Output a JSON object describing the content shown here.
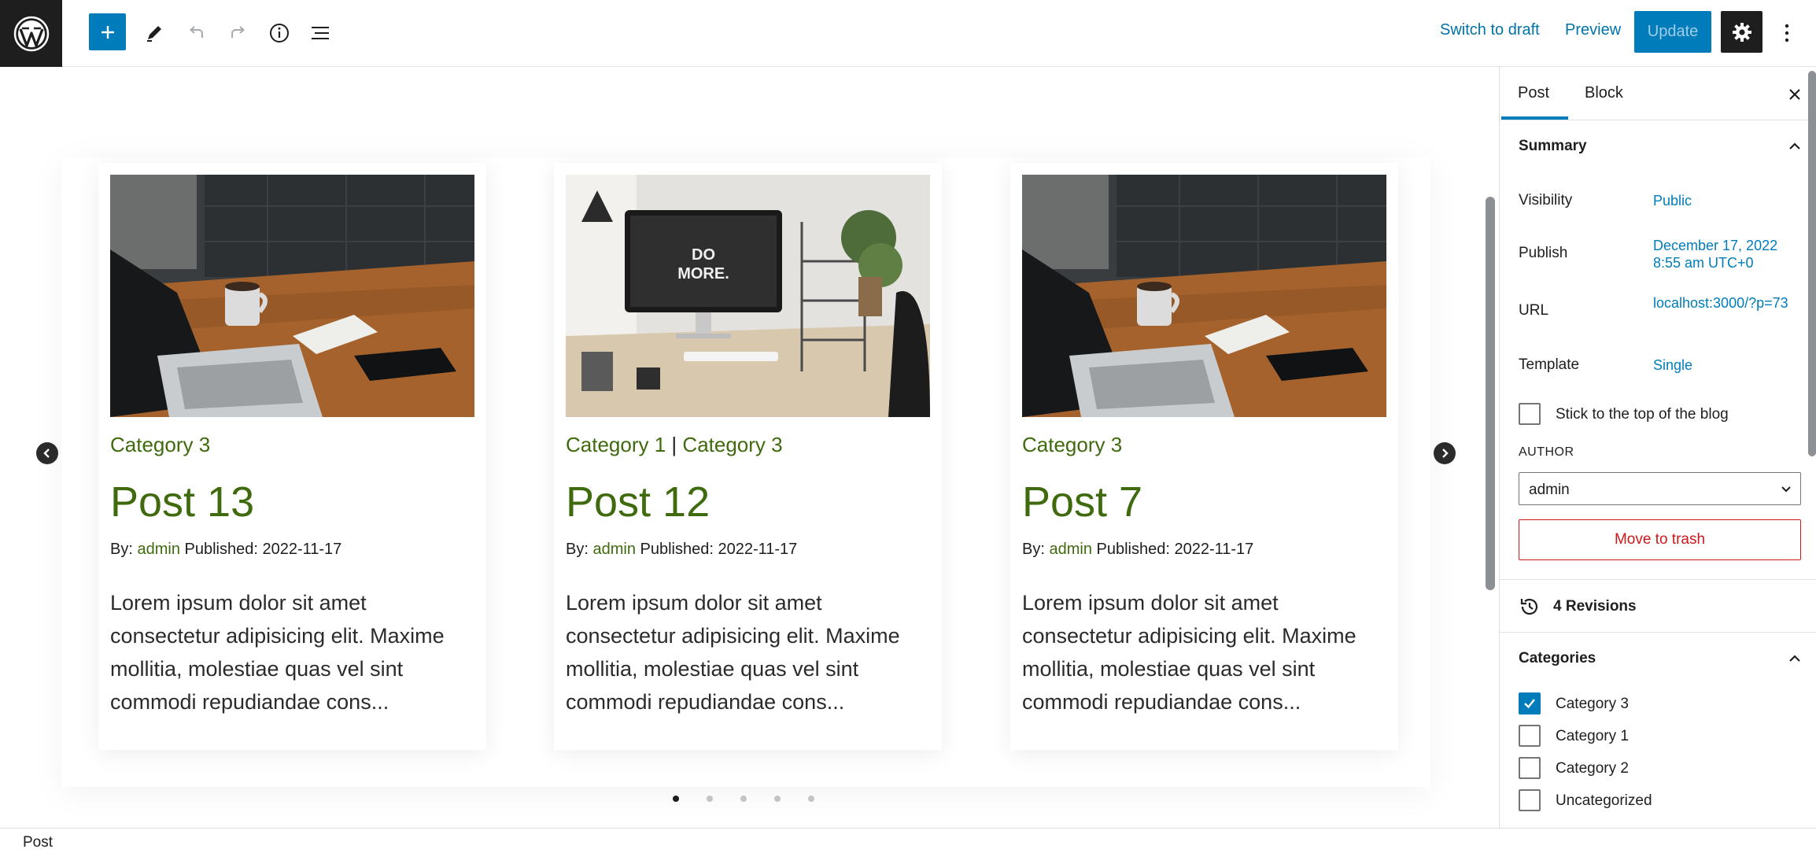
{
  "toolbar": {
    "switch_to_draft": "Switch to draft",
    "preview": "Preview",
    "update": "Update",
    "icons": [
      "wordpress-logo",
      "plus-icon",
      "pencil-icon",
      "undo-icon",
      "redo-icon",
      "info-icon",
      "list-view-icon",
      "gear-icon",
      "more-vertical-icon"
    ]
  },
  "carousel": {
    "cards": [
      {
        "image": "laptop-desk-photo",
        "category": "Category 3",
        "title": "Post 13",
        "by_label": "By:",
        "author": "admin",
        "published_label": "Published:",
        "date": "2022-11-17",
        "excerpt": "Lorem ipsum dolor sit amet consectetur adipisicing elit. Maxime mollitia, molestiae quas vel sint commodi repudiandae cons..."
      },
      {
        "image": "imac-do-more-photo",
        "category_a": "Category 1",
        "category_sep": "|",
        "category_b": "Category 3",
        "title": "Post 12",
        "by_label": "By:",
        "author": "admin",
        "published_label": "Published:",
        "date": "2022-11-17",
        "excerpt": "Lorem ipsum dolor sit amet consectetur adipisicing elit. Maxime mollitia, molestiae quas vel sint commodi repudiandae cons..."
      },
      {
        "image": "laptop-desk-photo",
        "category": "Category 3",
        "title": "Post 7",
        "by_label": "By:",
        "author": "admin",
        "published_label": "Published:",
        "date": "2022-11-17",
        "excerpt": "Lorem ipsum dolor sit amet consectetur adipisicing elit. Maxime mollitia, molestiae quas vel sint commodi repudiandae cons..."
      }
    ],
    "dots": 5,
    "active_dot": 0
  },
  "sidebar": {
    "tab_post": "Post",
    "tab_block": "Block",
    "summary": {
      "title": "Summary",
      "visibility_label": "Visibility",
      "visibility_value": "Public",
      "publish_label": "Publish",
      "publish_value": "December 17, 2022 8:55 am UTC+0",
      "url_label": "URL",
      "url_value": "localhost:3000/?p=73",
      "template_label": "Template",
      "template_value": "Single",
      "sticky_label": "Stick to the top of the blog",
      "sticky_checked": false,
      "author_label": "AUTHOR",
      "author_value": "admin",
      "trash_label": "Move to trash"
    },
    "revisions": "4 Revisions",
    "categories": {
      "title": "Categories",
      "items": [
        {
          "label": "Category 3",
          "checked": true
        },
        {
          "label": "Category 1",
          "checked": false
        },
        {
          "label": "Category 2",
          "checked": false
        },
        {
          "label": "Uncategorized",
          "checked": false
        }
      ]
    }
  },
  "footer": {
    "breadcrumb": "Post"
  },
  "colors": {
    "accent": "#007cba",
    "category_green": "#3f6a0e",
    "danger": "#cc1818",
    "dark": "#1e1e1e"
  }
}
